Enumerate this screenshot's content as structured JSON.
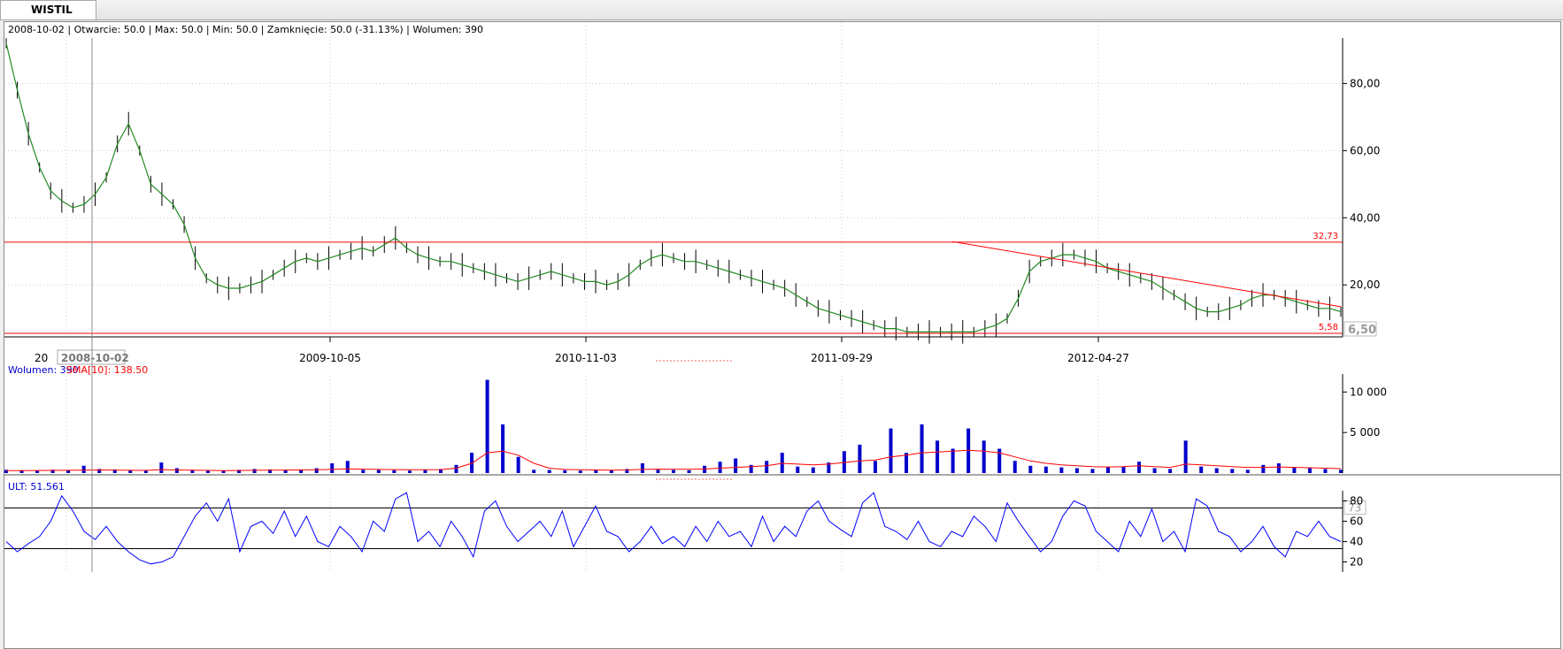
{
  "tab": {
    "label": "WISTIL"
  },
  "info_bar": "2008-10-02 | Otwarcie: 50.0 | Max: 50.0 | Min: 50.0 | Zamknięcie: 50.0 (-31.13%)  | Wolumen: 390",
  "cursor": {
    "date_label": "2008-10-02",
    "date_prefix": "20"
  },
  "panels": {
    "volume_legend": {
      "volume": "Wolumen: 390",
      "sma": "SMA[10]: 138.50"
    },
    "ult_legend": "ULT: 51.561"
  },
  "chart_data": [
    {
      "type": "line",
      "name": "price",
      "x_ticks": [
        "2009-10-05",
        "2010-11-03",
        "2011-09-29",
        "2012-04-27"
      ],
      "y_ticks": [
        "20,00",
        "40,00",
        "60,00",
        "80,00"
      ],
      "ylim": [
        5.58,
        93
      ],
      "hlines": [
        {
          "value": 32.73,
          "label": "32,73",
          "color": "#ff0000"
        },
        {
          "value": 5.58,
          "label": "5,58",
          "color": "#ff0000"
        }
      ],
      "trendline": {
        "from": [
          0.709,
          32.9
        ],
        "to": [
          1.0,
          13.5
        ],
        "color": "#ff0000"
      },
      "last_value_badge": "6,50",
      "grid": true,
      "colors": {
        "line": "#228b22",
        "bars": "#000000"
      },
      "series": [
        {
          "values": [
            92,
            78,
            65,
            55,
            48,
            45,
            43,
            44,
            47,
            52,
            62,
            68,
            60,
            50,
            47,
            44,
            38,
            28,
            22,
            20,
            19,
            19,
            20,
            21,
            23,
            25,
            27,
            28,
            27,
            28,
            29,
            30,
            31,
            30,
            32,
            34,
            31,
            29,
            28,
            27,
            27,
            26,
            25,
            24,
            23,
            22,
            21,
            22,
            23,
            24,
            23,
            22,
            21,
            21,
            20,
            21,
            23,
            26,
            28,
            29,
            28,
            27,
            27,
            26,
            25,
            24,
            23,
            22,
            21,
            20,
            19,
            17,
            15,
            13,
            12,
            11,
            10,
            9,
            8,
            7,
            7,
            6,
            6,
            6,
            6,
            6,
            6,
            6,
            7,
            8,
            10,
            16,
            24,
            27,
            28,
            29,
            29,
            28,
            27,
            25,
            24,
            23,
            22,
            21,
            19,
            17,
            15,
            13,
            12,
            12,
            13,
            14,
            16,
            17,
            17,
            16,
            15,
            14,
            13,
            13,
            12
          ]
        }
      ]
    },
    {
      "type": "bar",
      "name": "volume",
      "y_ticks": [
        "5 000",
        "10 000"
      ],
      "ylim": [
        0,
        12000
      ],
      "colors": {
        "bars": "#0000cc",
        "sma": "#ff0000"
      },
      "series": [
        {
          "name": "Wolumen",
          "values": [
            400,
            350,
            300,
            420,
            380,
            900,
            500,
            450,
            380,
            350,
            1300,
            600,
            400,
            350,
            300,
            400,
            500,
            450,
            380,
            400,
            600,
            1200,
            1500,
            400,
            380,
            350,
            300,
            400,
            500,
            1000,
            2500,
            11500,
            6000,
            2000,
            400,
            380,
            350,
            300,
            400,
            350,
            500,
            1200,
            400,
            380,
            350,
            900,
            1400,
            1800,
            1000,
            1500,
            2500,
            800,
            700,
            1300,
            2700,
            3500,
            1500,
            5500,
            2500,
            6000,
            4000,
            3000,
            5500,
            4000,
            3000,
            1500,
            900,
            800,
            700,
            600,
            500,
            700,
            800,
            1400,
            600,
            500,
            4000,
            800,
            600,
            500,
            400,
            1000,
            1200,
            700,
            600,
            500,
            400
          ]
        },
        {
          "name": "SMA[10]",
          "values": [
            300,
            310,
            320,
            330,
            340,
            360,
            380,
            360,
            340,
            330,
            420,
            380,
            350,
            330,
            310,
            320,
            340,
            360,
            370,
            380,
            400,
            450,
            520,
            480,
            450,
            420,
            400,
            410,
            430,
            600,
            1200,
            2500,
            2700,
            2200,
            1200,
            600,
            450,
            400,
            380,
            360,
            380,
            450,
            480,
            470,
            460,
            500,
            600,
            700,
            800,
            900,
            1200,
            1100,
            1000,
            1100,
            1300,
            1500,
            1600,
            2000,
            2200,
            2500,
            2600,
            2700,
            2800,
            2700,
            2500,
            2000,
            1500,
            1200,
            1000,
            900,
            800,
            750,
            800,
            900,
            800,
            700,
            1100,
            1000,
            900,
            800,
            700,
            700,
            750,
            700,
            650,
            600,
            550
          ]
        }
      ]
    },
    {
      "type": "line",
      "name": "ULT",
      "y_ticks": [
        "20",
        "40",
        "60",
        "80"
      ],
      "ylim": [
        10,
        90
      ],
      "hlines": [
        {
          "value": 73,
          "label": "73",
          "color": "#000000"
        },
        {
          "value": 33,
          "label": "",
          "color": "#000000"
        }
      ],
      "colors": {
        "line": "#0000ff"
      },
      "series": [
        {
          "values": [
            40,
            30,
            38,
            45,
            60,
            85,
            70,
            50,
            42,
            55,
            40,
            30,
            22,
            18,
            20,
            25,
            45,
            65,
            78,
            60,
            82,
            30,
            55,
            60,
            48,
            70,
            45,
            65,
            40,
            35,
            55,
            45,
            30,
            60,
            50,
            82,
            88,
            40,
            50,
            35,
            60,
            45,
            25,
            70,
            80,
            55,
            40,
            50,
            60,
            45,
            70,
            35,
            55,
            75,
            50,
            45,
            30,
            40,
            55,
            38,
            45,
            35,
            55,
            40,
            60,
            45,
            50,
            35,
            65,
            40,
            55,
            45,
            70,
            80,
            60,
            52,
            45,
            78,
            88,
            55,
            50,
            42,
            60,
            40,
            35,
            50,
            45,
            65,
            55,
            40,
            78,
            60,
            45,
            30,
            40,
            65,
            80,
            75,
            50,
            40,
            30,
            60,
            45,
            72,
            40,
            50,
            30,
            82,
            75,
            50,
            45,
            30,
            40,
            55,
            35,
            25,
            50,
            45,
            60,
            45,
            40
          ]
        }
      ]
    }
  ]
}
